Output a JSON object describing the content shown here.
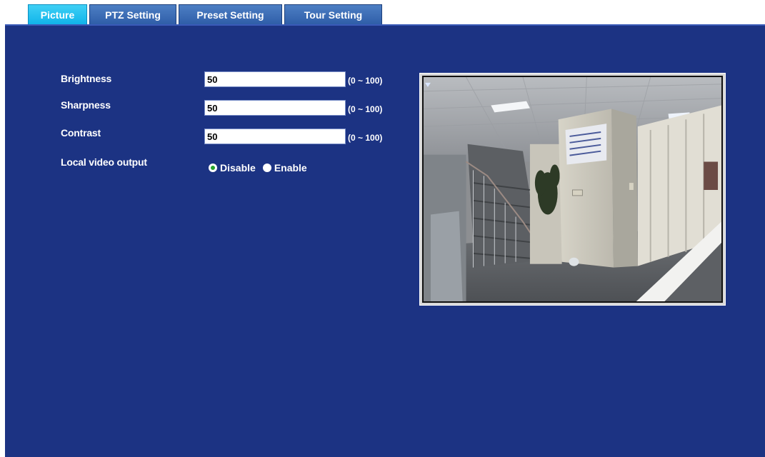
{
  "tabs": [
    {
      "label": "Picture",
      "active": true
    },
    {
      "label": "PTZ Setting",
      "active": false
    },
    {
      "label": "Preset Setting",
      "active": false
    },
    {
      "label": "Tour Setting",
      "active": false
    }
  ],
  "form": {
    "brightness": {
      "label": "Brightness",
      "value": "50",
      "range": "(0 ~ 100)"
    },
    "sharpness": {
      "label": "Sharpness",
      "value": "50",
      "range": "(0 ~ 100)"
    },
    "contrast": {
      "label": "Contrast",
      "value": "50",
      "range": "(0 ~ 100)"
    },
    "local_video_output": {
      "label": "Local video output",
      "options": [
        "Disable",
        "Enable"
      ],
      "selected": "Disable"
    }
  },
  "colors": {
    "panel_bg": "#1c3383",
    "tab_active": "#11b4ea",
    "tab_inactive": "#2f5ea8",
    "radio_checked": "#25a32b"
  },
  "icons": {
    "video_preview": "camera-live-view"
  }
}
